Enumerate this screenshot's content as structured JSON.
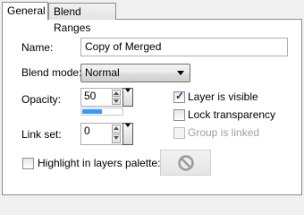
{
  "tabs": [
    {
      "label": "General",
      "active": true
    },
    {
      "label": "Blend Ranges",
      "active": false
    }
  ],
  "name": {
    "label": "Name:",
    "value": "Copy of Merged"
  },
  "blend_mode": {
    "label": "Blend mode:",
    "value": "Normal"
  },
  "opacity": {
    "label": "Opacity:",
    "value": "50",
    "slider_fraction": 0.5
  },
  "link_set": {
    "label": "Link set:",
    "value": "0"
  },
  "checkboxes": {
    "layer_visible": {
      "label": "Layer is visible",
      "checked": true,
      "enabled": true
    },
    "lock_transparency": {
      "label": "Lock transparency",
      "checked": false,
      "enabled": true
    },
    "group_linked": {
      "label": "Group is linked",
      "checked": false,
      "enabled": false
    },
    "highlight": {
      "label": "Highlight in layers palette:",
      "checked": false,
      "enabled": true
    }
  },
  "highlight_color_button": {
    "icon": "no-sign-icon"
  },
  "colors": {
    "accent": "#3399ff",
    "check": "#1c3a70",
    "disabled_text": "#a0a0a0"
  }
}
